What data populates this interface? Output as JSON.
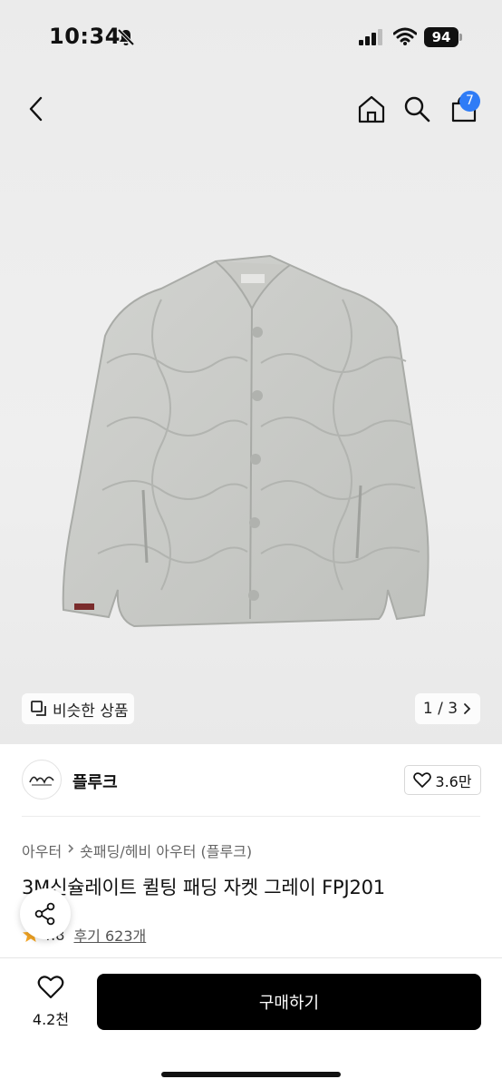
{
  "status_bar": {
    "time": "10:34",
    "battery": "94"
  },
  "nav": {
    "cart_count": "7"
  },
  "gallery": {
    "similar_label": "비슷한 상품",
    "pager": "1 / 3"
  },
  "brand": {
    "name": "플루크",
    "likes": "3.6만"
  },
  "breadcrumb": {
    "level1": "아우터",
    "level2": "숏패딩/헤비 아우터 (플루크)"
  },
  "product": {
    "title": "3M신슐레이트 퀼팅 패딩 자켓 그레이 FPJ201",
    "rating": "4.8",
    "reviews": "후기 623개"
  },
  "bottom": {
    "wish_count": "4.2천",
    "buy_label": "구매하기"
  },
  "colors": {
    "accent": "#2f7cf6",
    "star": "#f5a623",
    "buy_bg": "#000000"
  }
}
